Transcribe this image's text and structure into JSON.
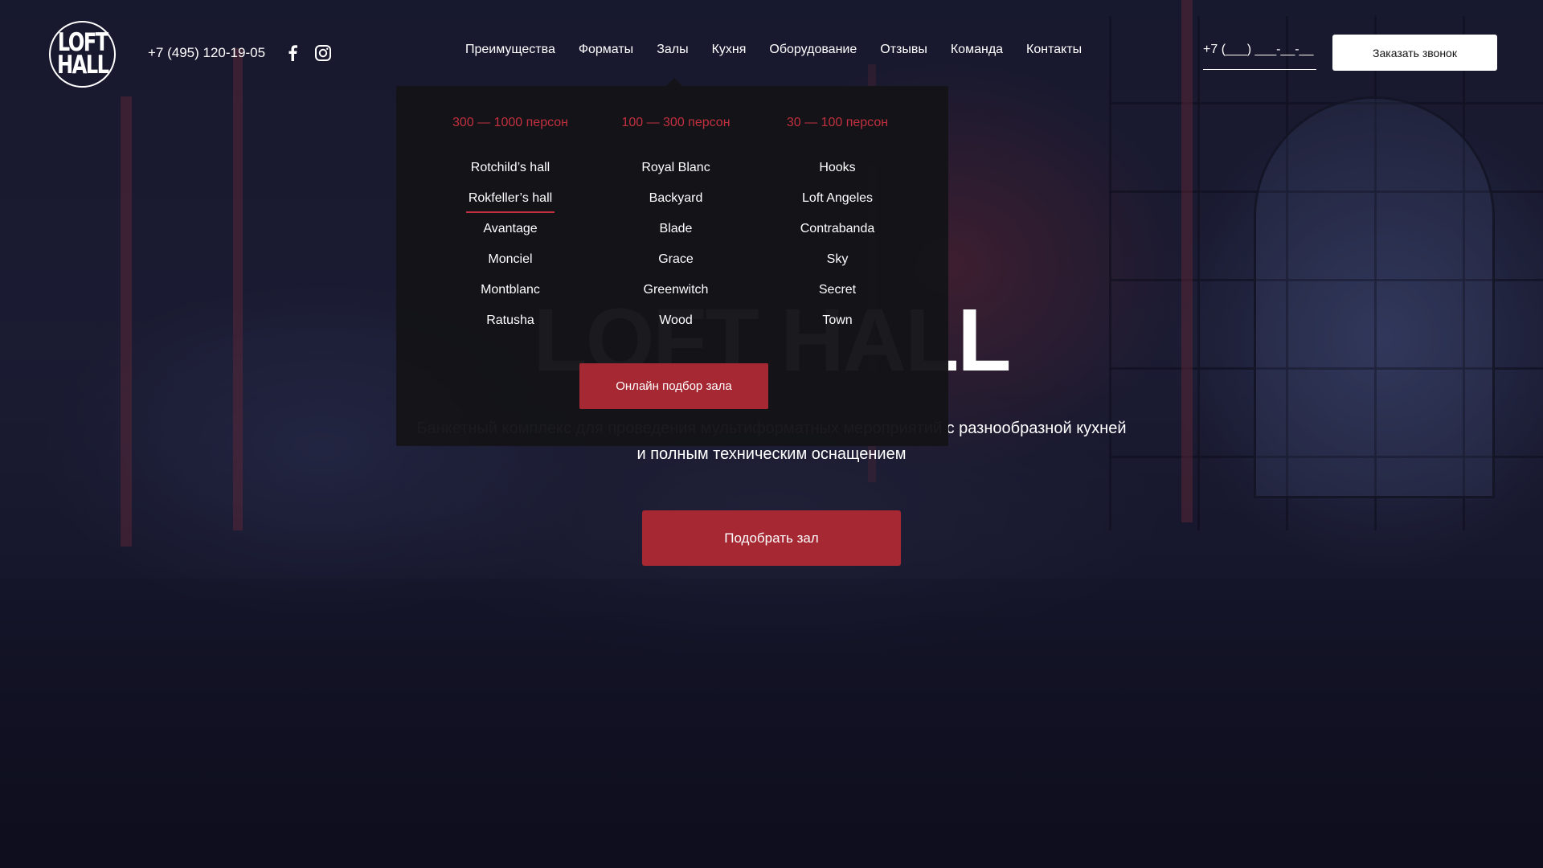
{
  "header": {
    "logo_line1": "LOFT",
    "logo_line2": "HALL",
    "phone": "+7 (495) 120-19-05",
    "social_icons": [
      "facebook-icon",
      "instagram-icon"
    ],
    "nav": [
      "Преимущества",
      "Форматы",
      "Залы",
      "Кухня",
      "Оборудование",
      "Отзывы",
      "Команда",
      "Контакты"
    ],
    "phone_input_placeholder": "+7 (___) ___-__-__",
    "call_button": "Заказать звонок"
  },
  "hero": {
    "title": "LOFT HALL",
    "subtitle_line1": "Банкетный комплекс для проведения мультиформатных мероприятий с разнообразной кухней",
    "subtitle_line2": "и полным техническим оснащением",
    "button": "Подобрать зал"
  },
  "dropdown": {
    "columns": [
      {
        "heading": "300  — 1000 персон",
        "items": [
          "Rotchild’s hall",
          "Rokfeller’s hall",
          "Avantage",
          "Monciel",
          "Montblanc",
          "Ratusha"
        ]
      },
      {
        "heading": "100 — 300 персон",
        "items": [
          "Royal Blanc",
          "Backyard",
          "Blade",
          "Grace",
          "Greenwitch",
          "Wood"
        ]
      },
      {
        "heading": "30 — 100 персон",
        "items": [
          "Hooks",
          "Loft Angeles",
          "Contrabanda",
          "Sky",
          "Secret",
          "Town"
        ]
      }
    ],
    "active_item": "Rokfeller’s hall",
    "button": "Онлайн подбор зала"
  },
  "colors": {
    "accent": "#a52833",
    "accent_text": "#c33040",
    "dropdown_bg": "#141418"
  }
}
